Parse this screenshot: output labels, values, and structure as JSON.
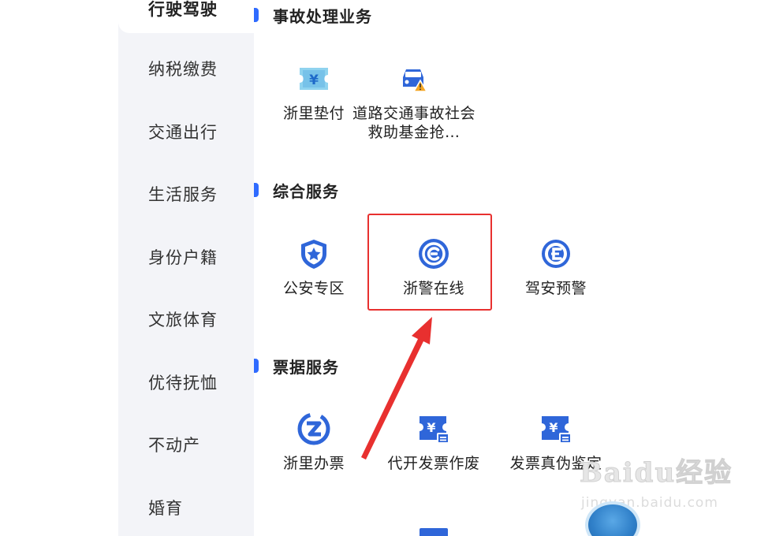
{
  "sidebar": {
    "items": [
      {
        "label": "行驶驾驶",
        "active": true
      },
      {
        "label": "纳税缴费"
      },
      {
        "label": "交通出行"
      },
      {
        "label": "生活服务"
      },
      {
        "label": "身份户籍"
      },
      {
        "label": "文旅体育"
      },
      {
        "label": "优待抚恤"
      },
      {
        "label": "不动产"
      },
      {
        "label": "婚育"
      }
    ]
  },
  "sections": [
    {
      "title": "事故处理业务",
      "items": [
        {
          "label": "浙里垫付",
          "icon": "yuan-ticket-icon"
        },
        {
          "label": "道路交通事故社会救助基金抢…",
          "icon": "car-warning-icon"
        }
      ]
    },
    {
      "title": "综合服务",
      "items": [
        {
          "label": "公安专区",
          "icon": "police-shield-icon"
        },
        {
          "label": "浙警在线",
          "icon": "police-online-icon",
          "highlighted": true
        },
        {
          "label": "驾安预警",
          "icon": "car-alert-icon"
        }
      ]
    },
    {
      "title": "票据服务",
      "items": [
        {
          "label": "浙里办票",
          "icon": "ticket-z-icon"
        },
        {
          "label": "代开发票作废",
          "icon": "invoice-void-icon"
        },
        {
          "label": "发票真伪鉴定",
          "icon": "invoice-check-icon"
        }
      ]
    }
  ],
  "watermark": {
    "brand": "Baidu经验",
    "sub": "jingyan.baidu.com"
  },
  "colors": {
    "accent": "#2f6bff",
    "icon_blue": "#2f66d9",
    "highlight": "#e8302f",
    "sidebar_bg": "#f3f4f8"
  }
}
